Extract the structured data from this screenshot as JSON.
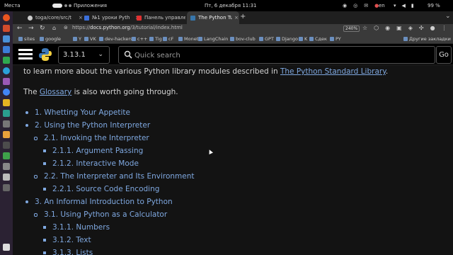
{
  "topbar": {
    "activities": "Места",
    "apps": "Приложения",
    "clock": "Пт, 6 декабря  11:31",
    "lang": "en",
    "battery": "99 %"
  },
  "tabs": [
    {
      "title": "toga/core/src/t",
      "active": false
    },
    {
      "title": "№1 уроки Pyth",
      "active": false
    },
    {
      "title": "Панель управле",
      "active": false
    },
    {
      "title": "The Python Tuto",
      "active": true
    }
  ],
  "newtab": "+",
  "nav": {
    "url_prefix": "https://",
    "url_host": "docs.python.org",
    "url_path": "/3/tutorial/index.html",
    "zoom": "240%"
  },
  "bookmarks": {
    "items": [
      "sites",
      "google",
      "Y",
      "VK",
      "dev-hackers",
      "c++",
      "Tig",
      "cF",
      "Moneta",
      "LangChain",
      "bov-club",
      "GPT",
      "Django",
      "K",
      "Сдек",
      "PY"
    ],
    "other": "Другие закладки"
  },
  "header": {
    "version": "3.13.1",
    "search_placeholder": "Quick search",
    "go_label": "Go"
  },
  "content": {
    "intro_text": "to learn more about the various Python library modules described in ",
    "intro_link": "The Python Standard Library",
    "intro_end": ".",
    "glossary_before": "The ",
    "glossary_link": "Glossary",
    "glossary_after": " is also worth going through.",
    "toc": [
      {
        "label": "1. Whetting Your Appetite",
        "level": 1
      },
      {
        "label": "2. Using the Python Interpreter",
        "level": 1
      },
      {
        "label": "2.1. Invoking the Interpreter",
        "level": 2
      },
      {
        "label": "2.1.1. Argument Passing",
        "level": 3
      },
      {
        "label": "2.1.2. Interactive Mode",
        "level": 3
      },
      {
        "label": "2.2. The Interpreter and Its Environment",
        "level": 2
      },
      {
        "label": "2.2.1. Source Code Encoding",
        "level": 3
      },
      {
        "label": "3. An Informal Introduction to Python",
        "level": 1
      },
      {
        "label": "3.1. Using Python as a Calculator",
        "level": 2
      },
      {
        "label": "3.1.1. Numbers",
        "level": 3
      },
      {
        "label": "3.1.2. Text",
        "level": 3
      },
      {
        "label": "3.1.3. Lists",
        "level": 3
      }
    ]
  },
  "colors": {
    "link": "#7fa8e0",
    "page_bg": "#131313",
    "header_bg": "#000000"
  }
}
